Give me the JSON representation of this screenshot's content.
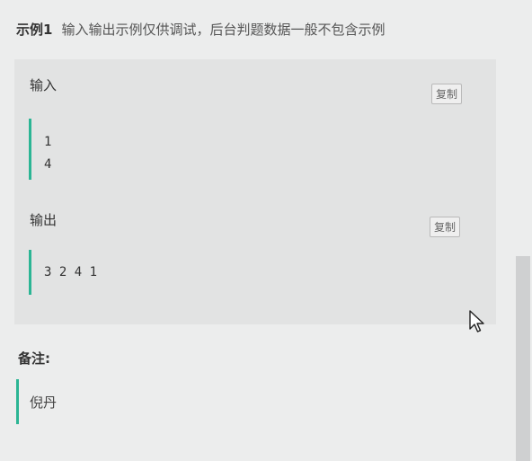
{
  "example": {
    "title": "示例1",
    "note": "输入输出示例仅供调试，后台判题数据一般不包含示例"
  },
  "input": {
    "label": "输入",
    "copy_label": "复制",
    "lines": [
      "1",
      "4"
    ]
  },
  "output": {
    "label": "输出",
    "copy_label": "复制",
    "lines": [
      "3 2 4 1"
    ]
  },
  "remark": {
    "label": "备注:",
    "text": "倪丹"
  },
  "colors": {
    "accent": "#2bb594",
    "box_bg": "#e2e3e3",
    "page_bg": "#eceded"
  },
  "icons": {
    "cursor": "mouse-pointer-icon"
  }
}
